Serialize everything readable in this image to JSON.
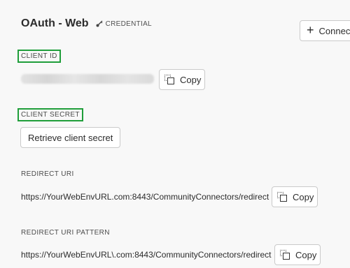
{
  "header": {
    "title": "OAuth - Web",
    "tag": "CREDENTIAL",
    "connect_label": "Connect"
  },
  "client_id": {
    "label": "CLIENT ID",
    "copy_label": "Copy"
  },
  "client_secret": {
    "label": "CLIENT SECRET",
    "retrieve_label": "Retrieve client secret"
  },
  "redirect_uri": {
    "label": "REDIRECT URI",
    "value": "https://YourWebEnvURL.com:8443/CommunityConnectors/redirect",
    "copy_label": "Copy"
  },
  "redirect_uri_pattern": {
    "label": "REDIRECT URI PATTERN",
    "value": "https://YourWebEnvURL\\.com:8443/CommunityConnectors/redirect",
    "copy_label": "Copy"
  },
  "colors": {
    "highlight_border": "#1f9e3a",
    "background": "#f8f8f8"
  }
}
